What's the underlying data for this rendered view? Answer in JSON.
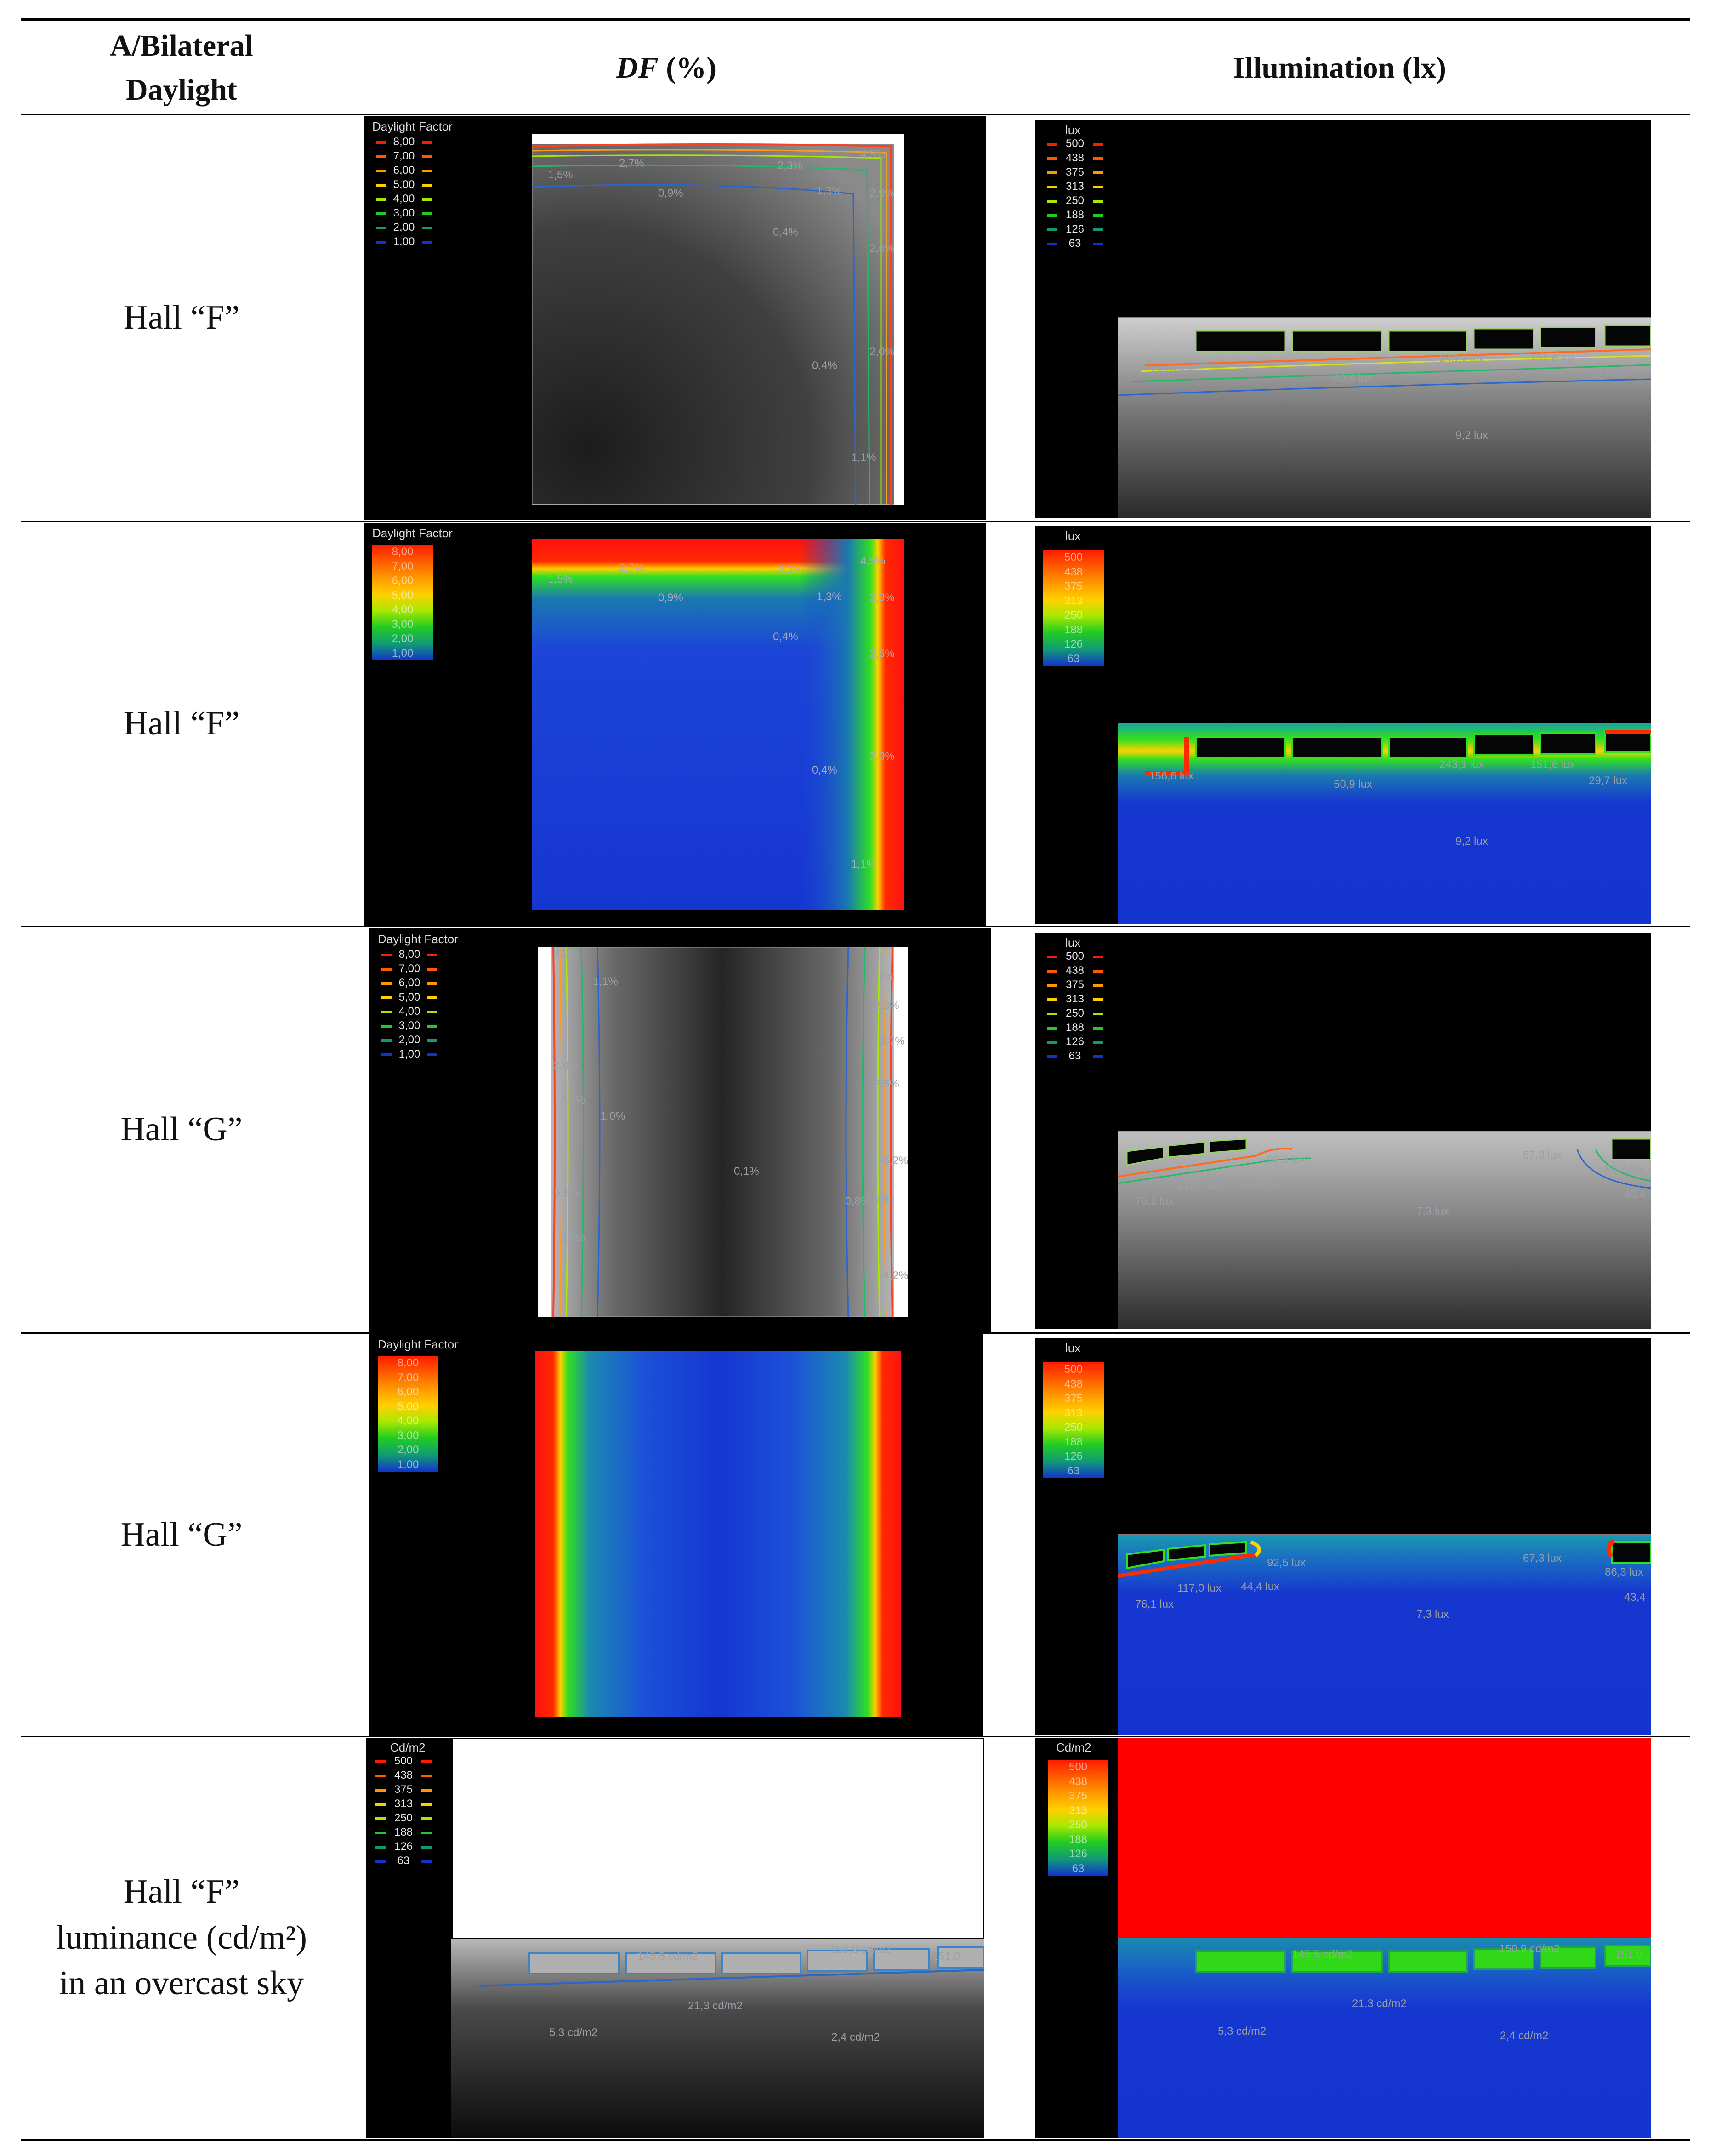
{
  "table": {
    "header": {
      "col1_line1": "A/Bilateral",
      "col1_line2": "Daylight",
      "col2_italic": "DF",
      "col2_rest": " (%)",
      "col3": "Illumination (lx)"
    },
    "rows": [
      {
        "label": "Hall “F”"
      },
      {
        "label": "Hall “F”"
      },
      {
        "label": "Hall “G”"
      },
      {
        "label": "Hall “G”"
      },
      {
        "label_lines": [
          "Hall “F”",
          "luminance (cd/m²)",
          "in an overcast sky"
        ]
      }
    ]
  },
  "legends": {
    "df_title": "Daylight Factor",
    "df_values": [
      "8,00",
      "7,00",
      "6,00",
      "5,00",
      "4,00",
      "3,00",
      "2,00",
      "1,00"
    ],
    "lux_title": "lux",
    "lux_values": [
      "500",
      "438",
      "375",
      "313",
      "250",
      "188",
      "126",
      "63"
    ],
    "cd_title": "Cd/m2",
    "cd_values": [
      "500",
      "438",
      "375",
      "313",
      "250",
      "188",
      "126",
      "63"
    ],
    "scale_colors": [
      "#ff1a00",
      "#ff5a00",
      "#ff9900",
      "#ffd000",
      "#a8e800",
      "#22cc22",
      "#119977",
      "#1133cc"
    ]
  },
  "annotations": {
    "hallF_df": [
      "1,5%",
      "2,7%",
      "2,3%",
      "4,5%",
      "0,9%",
      "1,3%",
      "2,9%",
      "0,4%",
      "2,6%",
      "2,0%",
      "0,4%",
      "1,1%"
    ],
    "hallF_lux": [
      "156,6 lux",
      "50,9 lux",
      "243,1 lux",
      "151,6 lux",
      "29,7 lux",
      "9,2 lux"
    ],
    "hallG_df": [
      "8,9%",
      "1,1%",
      "1,7%",
      "2,3%",
      "3,7%",
      "2,8%",
      "3,4%",
      "1,0%",
      "2,5%",
      "6,2%",
      "0,1%",
      "5,5%",
      "0,8%",
      "1,7%",
      "3,6%",
      "4,2%"
    ],
    "hallG_lux": [
      "92,5 lux",
      "67,3 lux",
      "117,0 lux",
      "44,4 lux",
      "76,1 lux",
      "7,3 lux",
      "43,4",
      "86,3 lux"
    ],
    "lum": [
      "145,5 cd/m2",
      "150,9 cd/m2",
      "151,0",
      "21,3 cd/m2",
      "5,3 cd/m2",
      "2,4 cd/m2"
    ]
  }
}
